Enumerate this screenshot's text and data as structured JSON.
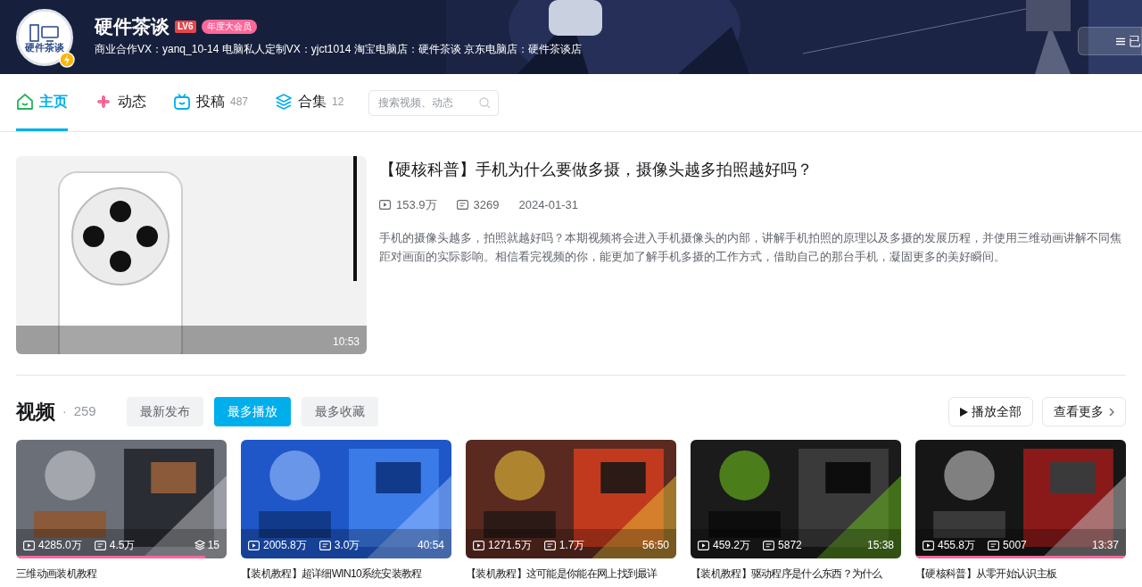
{
  "header": {
    "name": "硬件茶谈",
    "level_badge": "LV6",
    "vip_badge": "年度大会员",
    "bio": "商业合作VX：yanq_10-14 电脑私人定制VX：yjct1014 淘宝电脑店：硬件茶谈 京东电脑店：硬件茶谈店",
    "avatar_text": "硬件茶谈",
    "menu_button": "已"
  },
  "nav": {
    "tabs": [
      {
        "label": "主页",
        "selected": true
      },
      {
        "label": "动态",
        "selected": false
      },
      {
        "label": "投稿",
        "count": "487",
        "selected": false
      },
      {
        "label": "合集",
        "count": "12",
        "selected": false
      }
    ],
    "search": {
      "placeholder": "搜索视频、动态"
    }
  },
  "featured": {
    "title": "【硬核科普】手机为什么要做多摄，摄像头越多拍照越好吗？",
    "plays": "153.9万",
    "comments": "3269",
    "date": "2024-01-31",
    "duration": "10:53",
    "description": "手机的摄像头越多，拍照就越好吗？本期视频将会进入手机摄像头的内部，讲解手机拍照的原理以及多摄的发展历程，并使用三维动画讲解不同焦距对画面的实际影响。相信看完视频的你，能更加了解手机多摄的工作方式，借助自己的那台手机，凝固更多的美好瞬间。"
  },
  "videos": {
    "title": "视频",
    "separator": "·",
    "count": "259",
    "sorts": [
      {
        "label": "最新发布",
        "selected": false
      },
      {
        "label": "最多播放",
        "selected": true
      },
      {
        "label": "最多收藏",
        "selected": false
      }
    ],
    "play_all": "播放全部",
    "more": "查看更多",
    "items": [
      {
        "title": "三维动画装机教程",
        "plays": "4285.0万",
        "comments": "4.5万",
        "collection_count": "15",
        "level": 0.9
      },
      {
        "title": "【装机教程】超详细WIN10系统安装教程",
        "plays": "2005.8万",
        "comments": "3.0万",
        "duration": "40:54"
      },
      {
        "title": "【装机教程】这可能是你能在网上找到最详",
        "plays": "1271.5万",
        "comments": "1.7万",
        "duration": "56:50"
      },
      {
        "title": "【装机教程】驱动程序是什么东西？为什么",
        "plays": "459.2万",
        "comments": "5872",
        "duration": "15:38"
      },
      {
        "title": "【硬核科普】从零开始认识主板",
        "plays": "455.8万",
        "comments": "5007",
        "duration": "13:37",
        "level": 1
      }
    ]
  }
}
